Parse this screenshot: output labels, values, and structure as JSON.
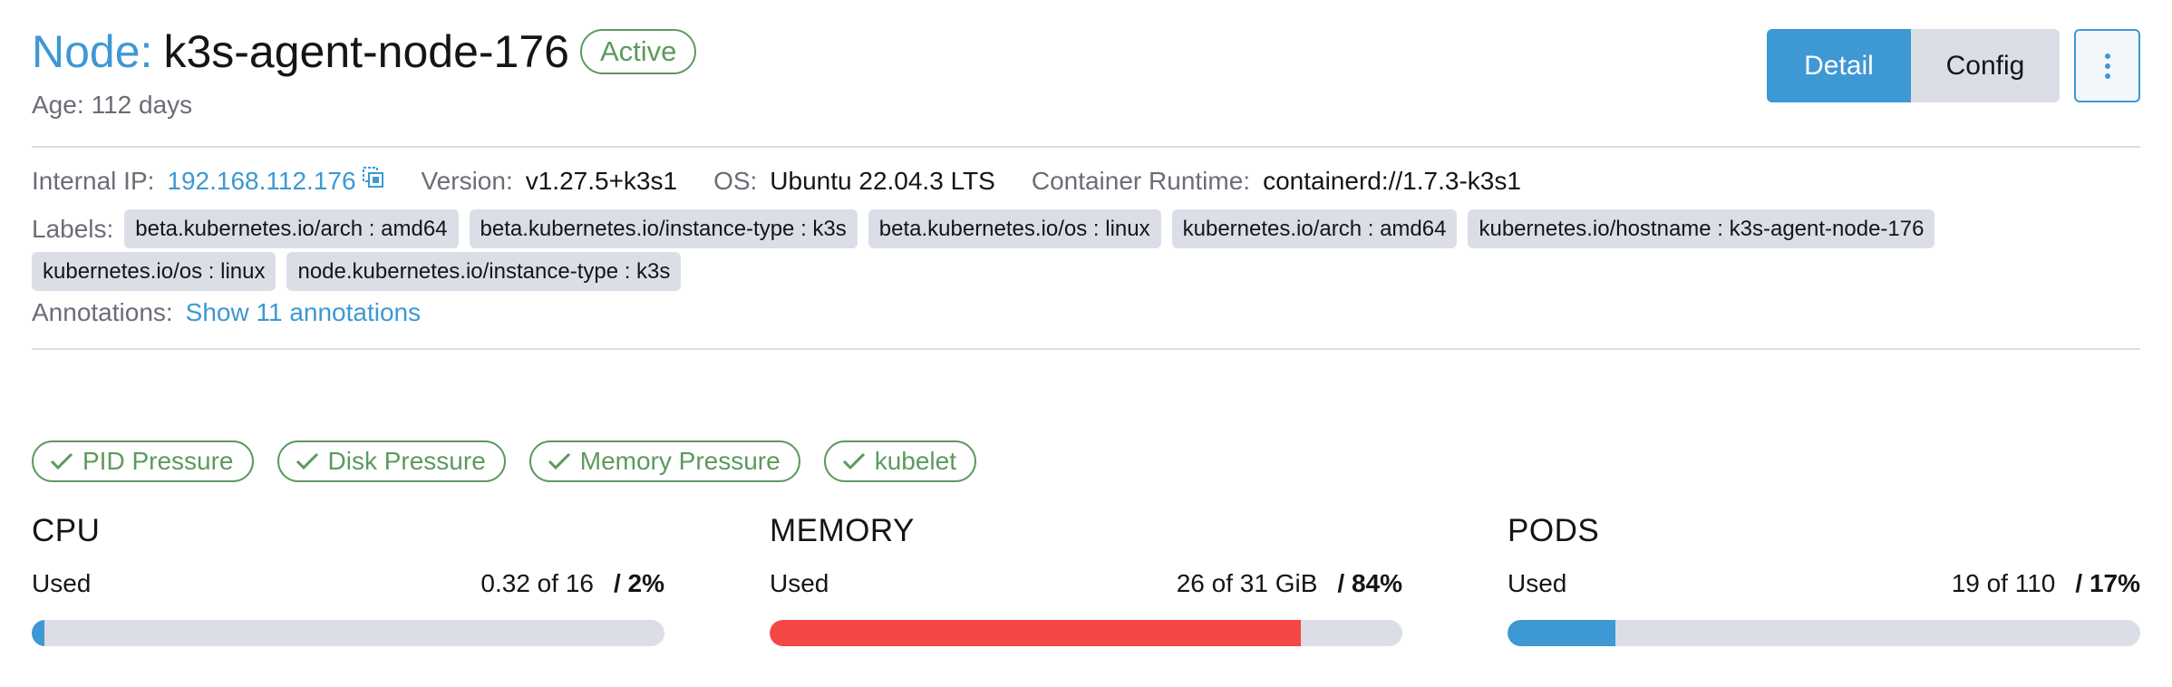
{
  "header": {
    "title_prefix": "Node:",
    "node_name": "k3s-agent-node-176",
    "status": "Active",
    "age_label": "Age:",
    "age_value": "112 days",
    "buttons": {
      "detail": "Detail",
      "config": "Config"
    }
  },
  "details": {
    "internal_ip_label": "Internal IP:",
    "internal_ip": "192.168.112.176",
    "version_label": "Version:",
    "version": "v1.27.5+k3s1",
    "os_label": "OS:",
    "os": "Ubuntu 22.04.3 LTS",
    "runtime_label": "Container Runtime:",
    "runtime": "containerd://1.7.3-k3s1",
    "labels_label": "Labels:",
    "labels": [
      "beta.kubernetes.io/arch : amd64",
      "beta.kubernetes.io/instance-type : k3s",
      "beta.kubernetes.io/os : linux",
      "kubernetes.io/arch : amd64",
      "kubernetes.io/hostname : k3s-agent-node-176",
      "kubernetes.io/os : linux",
      "node.kubernetes.io/instance-type : k3s"
    ],
    "annotations_label": "Annotations:",
    "annotations_link": "Show 11 annotations"
  },
  "conditions": [
    "PID Pressure",
    "Disk Pressure",
    "Memory Pressure",
    "kubelet"
  ],
  "gauges": [
    {
      "title": "CPU",
      "used_label": "Used",
      "amount": "0.32 of 16",
      "percent": "/ 2%",
      "fill_fraction": 0.02,
      "color": "#3d98d3"
    },
    {
      "title": "MEMORY",
      "used_label": "Used",
      "amount": "26 of 31 GiB",
      "percent": "/ 84%",
      "fill_fraction": 0.84,
      "color": "#f64747"
    },
    {
      "title": "PODS",
      "used_label": "Used",
      "amount": "19 of 110",
      "percent": "/ 17%",
      "fill_fraction": 0.17,
      "color": "#3d98d3"
    }
  ],
  "colors": {
    "accent": "#3d98d3",
    "success": "#5d995d",
    "error": "#f64747",
    "chip_bg": "#dcdee7"
  }
}
